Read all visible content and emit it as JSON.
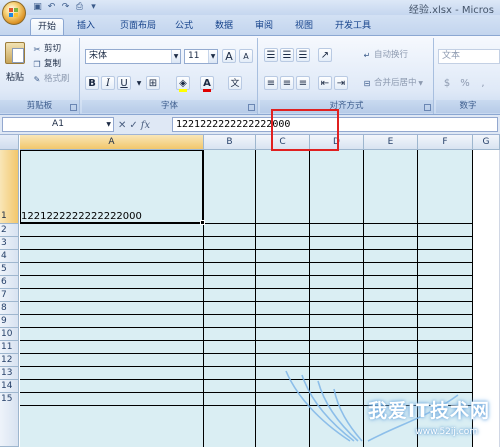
{
  "window": {
    "title": "经验.xlsx - Micros"
  },
  "tabs": [
    {
      "label": "开始",
      "active": true
    },
    {
      "label": "插入",
      "active": false
    },
    {
      "label": "页面布局",
      "active": false
    },
    {
      "label": "公式",
      "active": false
    },
    {
      "label": "数据",
      "active": false
    },
    {
      "label": "审阅",
      "active": false
    },
    {
      "label": "视图",
      "active": false
    },
    {
      "label": "开发工具",
      "active": false
    }
  ],
  "ribbon": {
    "clipboard": {
      "paste": "粘贴",
      "cut": "剪切",
      "copy": "复制",
      "format_painter": "格式刷",
      "label": "剪贴板"
    },
    "font": {
      "font_name": "宋体",
      "font_size": "11",
      "grow": "A",
      "shrink": "A",
      "bold": "B",
      "italic": "I",
      "underline": "U",
      "wen": "文",
      "label": "字体"
    },
    "alignment": {
      "wrap_text": "自动换行",
      "merge_center": "合并后居中",
      "label": "对齐方式"
    },
    "number": {
      "format": "文本",
      "label": "数字"
    }
  },
  "formula_bar": {
    "name_box": "A1",
    "fx_label": "fx",
    "value": "1221222222222222000"
  },
  "sheet": {
    "columns": [
      "A",
      "B",
      "C",
      "D",
      "E",
      "F",
      "G"
    ],
    "rows": [
      "1",
      "2",
      "3",
      "4",
      "5",
      "6",
      "7",
      "8",
      "9",
      "10",
      "11",
      "12",
      "13",
      "14",
      "15"
    ],
    "cell_A1": "1221222222222222000"
  },
  "watermark": {
    "text": "我爱IT技术网",
    "url": "www.52ij.com"
  },
  "colors": {
    "cell_fill": "#daeef3",
    "highlight_box": "#e02020",
    "selected_header": "#f2c76c"
  }
}
